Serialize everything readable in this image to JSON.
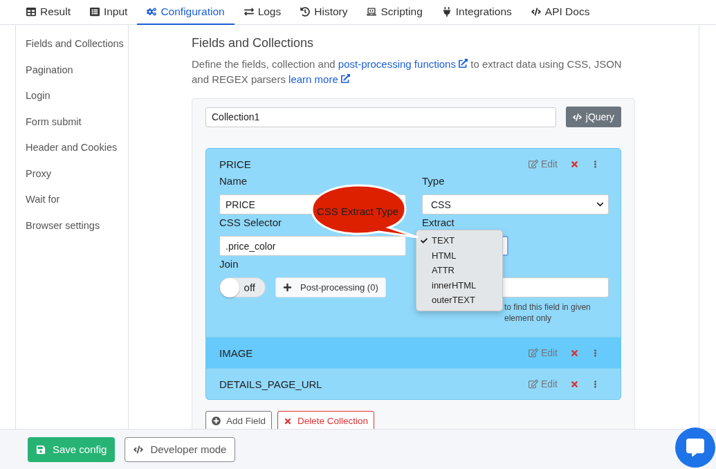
{
  "tabs": [
    {
      "label": "Result",
      "selected": false
    },
    {
      "label": "Input",
      "selected": false
    },
    {
      "label": "Configuration",
      "selected": true
    },
    {
      "label": "Logs",
      "selected": false
    },
    {
      "label": "History",
      "selected": false
    },
    {
      "label": "Scripting",
      "selected": false
    },
    {
      "label": "Integrations",
      "selected": false
    },
    {
      "label": "API Docs",
      "selected": false
    }
  ],
  "sidebar": {
    "items": [
      "Fields and Collections",
      "Pagination",
      "Login",
      "Form submit",
      "Header and Cookies",
      "Proxy",
      "Wait for",
      "Browser settings"
    ]
  },
  "section": {
    "title": "Fields and Collections",
    "text_1": "Define the fields, collection and",
    "link_1": "post-processing functions",
    "text_2": "to extract data using CSS, JSON and REGEX parsers",
    "link_2": "learn more"
  },
  "collection": {
    "name": "Collection1",
    "mode_button": "jQuery",
    "fields": [
      {
        "name": "PRICE",
        "expanded": true,
        "highlighted": false,
        "edit": "Edit"
      },
      {
        "name": "IMAGE",
        "expanded": false,
        "highlighted": true,
        "edit": "Edit"
      },
      {
        "name": "DETAILS_PAGE_URL",
        "expanded": false,
        "highlighted": false,
        "edit": "Edit"
      }
    ],
    "form": {
      "name_label": "Name",
      "name_value": "PRICE",
      "selector_label": "CSS Selector",
      "selector_value": ".price_color",
      "join_label": "Join",
      "join": {
        "on": false,
        "label": "off"
      },
      "post_processing": "Post-processing (0)",
      "type_label": "Type",
      "type_value": "CSS",
      "extract_label": "Extract",
      "help_1": "to find this field in given",
      "help_2": "element only"
    },
    "add_field": "Add Field",
    "delete": "Delete Collection"
  },
  "dropdown": {
    "options": [
      {
        "label": "TEXT",
        "selected": true
      },
      {
        "label": "HTML",
        "selected": false
      },
      {
        "label": "ATTR",
        "selected": false
      },
      {
        "label": "innerHTML",
        "selected": false
      },
      {
        "label": "outerTEXT",
        "selected": false
      }
    ]
  },
  "callout": "CSS Extract Type",
  "footer": {
    "save": "Save config",
    "developer": "Developer mode"
  }
}
